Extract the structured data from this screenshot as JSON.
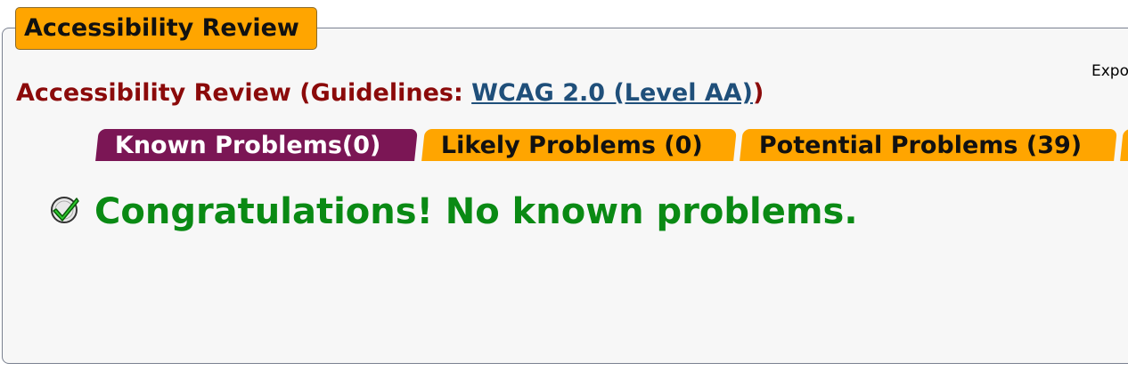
{
  "panel": {
    "legend": "Accessibility Review",
    "export_label": "Expo"
  },
  "guidelines": {
    "prefix": "Accessibility Review (Guidelines: ",
    "link_text": "WCAG 2.0 (Level AA)",
    "suffix": ")"
  },
  "tabs": [
    {
      "label": "Known Problems(0)",
      "active": true
    },
    {
      "label": "Likely Problems (0)",
      "active": false
    },
    {
      "label": "Potential Problems (39)",
      "active": false
    },
    {
      "label": "",
      "active": false
    }
  ],
  "message": {
    "icon": "check-icon",
    "text": "Congratulations! No known problems."
  },
  "colors": {
    "legend_bg": "#ffa500",
    "active_tab": "#7b1655",
    "inactive_tab": "#ffa500",
    "heading": "#8b0a0a",
    "link": "#1f4f7a",
    "success": "#0a8a14"
  }
}
